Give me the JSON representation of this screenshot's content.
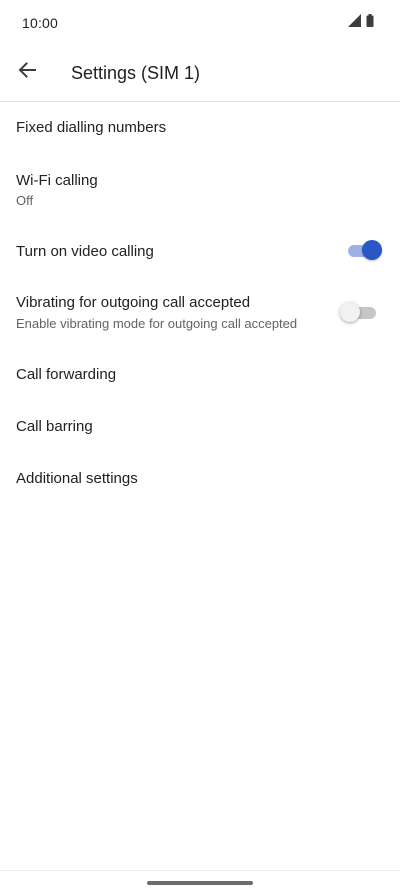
{
  "status_bar": {
    "time": "10:00",
    "icons": [
      "signal-icon",
      "battery-icon"
    ]
  },
  "app_bar": {
    "back_icon": "arrow-back-icon",
    "title": "Settings (SIM 1)"
  },
  "settings": [
    {
      "title": "Fixed dialling numbers"
    },
    {
      "title": "Wi-Fi calling",
      "subtitle": "Off"
    },
    {
      "title": "Turn on video calling",
      "toggle": true
    },
    {
      "title": "Vibrating for outgoing call accepted",
      "subtitle": "Enable vibrating mode for outgoing call accepted",
      "toggle": false
    },
    {
      "title": "Call forwarding"
    },
    {
      "title": "Call barring"
    },
    {
      "title": "Additional settings"
    }
  ],
  "colors": {
    "accent": "#2a56c6",
    "accent_track": "#9fb0e8",
    "text_primary": "#202124",
    "text_secondary": "#5f6368"
  }
}
